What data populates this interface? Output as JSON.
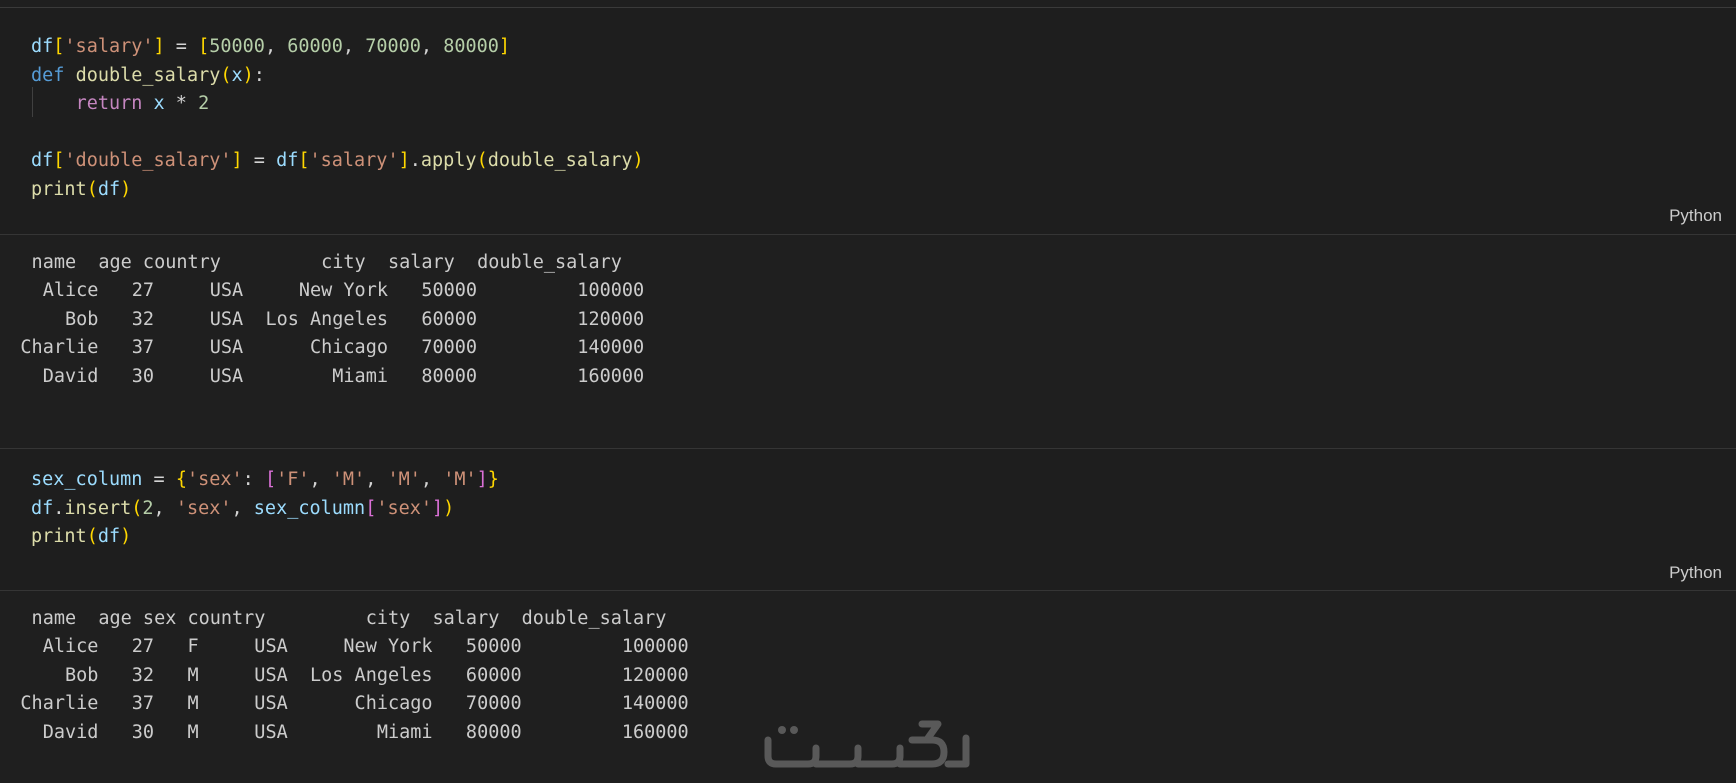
{
  "cells": [
    {
      "language": "Python",
      "code_lines": [
        [
          {
            "t": "df",
            "c": "var"
          },
          {
            "t": "[",
            "c": "br1"
          },
          {
            "t": "'salary'",
            "c": "str"
          },
          {
            "t": "]",
            "c": "br1"
          },
          {
            "t": " = ",
            "c": "op"
          },
          {
            "t": "[",
            "c": "br1"
          },
          {
            "t": "50000",
            "c": "num"
          },
          {
            "t": ", ",
            "c": "op"
          },
          {
            "t": "60000",
            "c": "num"
          },
          {
            "t": ", ",
            "c": "op"
          },
          {
            "t": "70000",
            "c": "num"
          },
          {
            "t": ", ",
            "c": "op"
          },
          {
            "t": "80000",
            "c": "num"
          },
          {
            "t": "]",
            "c": "br1"
          }
        ],
        [
          {
            "t": "def",
            "c": "kw"
          },
          {
            "t": " ",
            "c": "op"
          },
          {
            "t": "double_salary",
            "c": "fn"
          },
          {
            "t": "(",
            "c": "br1"
          },
          {
            "t": "x",
            "c": "var"
          },
          {
            "t": ")",
            "c": "br1"
          },
          {
            "t": ":",
            "c": "op"
          }
        ],
        [
          {
            "t": "    ",
            "c": "op"
          },
          {
            "t": "return",
            "c": "ctrl"
          },
          {
            "t": " ",
            "c": "op"
          },
          {
            "t": "x",
            "c": "var"
          },
          {
            "t": " * ",
            "c": "op"
          },
          {
            "t": "2",
            "c": "num"
          }
        ],
        [],
        [
          {
            "t": "df",
            "c": "var"
          },
          {
            "t": "[",
            "c": "br1"
          },
          {
            "t": "'double_salary'",
            "c": "str"
          },
          {
            "t": "]",
            "c": "br1"
          },
          {
            "t": " = ",
            "c": "op"
          },
          {
            "t": "df",
            "c": "var"
          },
          {
            "t": "[",
            "c": "br1"
          },
          {
            "t": "'salary'",
            "c": "str"
          },
          {
            "t": "]",
            "c": "br1"
          },
          {
            "t": ".",
            "c": "op"
          },
          {
            "t": "apply",
            "c": "fn"
          },
          {
            "t": "(",
            "c": "br1"
          },
          {
            "t": "double_salary",
            "c": "fn"
          },
          {
            "t": ")",
            "c": "br1"
          }
        ],
        [
          {
            "t": "print",
            "c": "fn"
          },
          {
            "t": "(",
            "c": "br1"
          },
          {
            "t": "df",
            "c": "var"
          },
          {
            "t": ")",
            "c": "br1"
          }
        ]
      ],
      "output_lines": [
        "    name  age country         city  salary  double_salary",
        "0    Alice   27     USA     New York   50000         100000",
        "1      Bob   32     USA  Los Angeles   60000         120000",
        "2  Charlie   37     USA      Chicago   70000         140000",
        "3    David   30     USA        Miami   80000         160000"
      ]
    },
    {
      "language": "Python",
      "code_lines": [
        [
          {
            "t": "sex_column",
            "c": "var"
          },
          {
            "t": " = ",
            "c": "op"
          },
          {
            "t": "{",
            "c": "br1"
          },
          {
            "t": "'sex'",
            "c": "str"
          },
          {
            "t": ": ",
            "c": "op"
          },
          {
            "t": "[",
            "c": "br2"
          },
          {
            "t": "'F'",
            "c": "str"
          },
          {
            "t": ", ",
            "c": "op"
          },
          {
            "t": "'M'",
            "c": "str"
          },
          {
            "t": ", ",
            "c": "op"
          },
          {
            "t": "'M'",
            "c": "str"
          },
          {
            "t": ", ",
            "c": "op"
          },
          {
            "t": "'M'",
            "c": "str"
          },
          {
            "t": "]",
            "c": "br2"
          },
          {
            "t": "}",
            "c": "br1"
          }
        ],
        [
          {
            "t": "df",
            "c": "var"
          },
          {
            "t": ".",
            "c": "op"
          },
          {
            "t": "insert",
            "c": "fn"
          },
          {
            "t": "(",
            "c": "br1"
          },
          {
            "t": "2",
            "c": "num"
          },
          {
            "t": ", ",
            "c": "op"
          },
          {
            "t": "'sex'",
            "c": "str"
          },
          {
            "t": ", ",
            "c": "op"
          },
          {
            "t": "sex_column",
            "c": "var"
          },
          {
            "t": "[",
            "c": "br2"
          },
          {
            "t": "'sex'",
            "c": "str"
          },
          {
            "t": "]",
            "c": "br2"
          },
          {
            "t": ")",
            "c": "br1"
          }
        ],
        [
          {
            "t": "print",
            "c": "fn"
          },
          {
            "t": "(",
            "c": "br1"
          },
          {
            "t": "df",
            "c": "var"
          },
          {
            "t": ")",
            "c": "br1"
          }
        ]
      ],
      "output_lines": [
        "    name  age sex country         city  salary  double_salary",
        "0    Alice   27   F     USA     New York   50000         100000",
        "1      Bob   32   M     USA  Los Angeles   60000         120000",
        "2  Charlie   37   M     USA      Chicago   70000         140000",
        "3    David   30   M     USA        Miami   80000         160000"
      ]
    }
  ],
  "watermark": {
    "text": "خمسات",
    "color": "#5a5a5a"
  }
}
